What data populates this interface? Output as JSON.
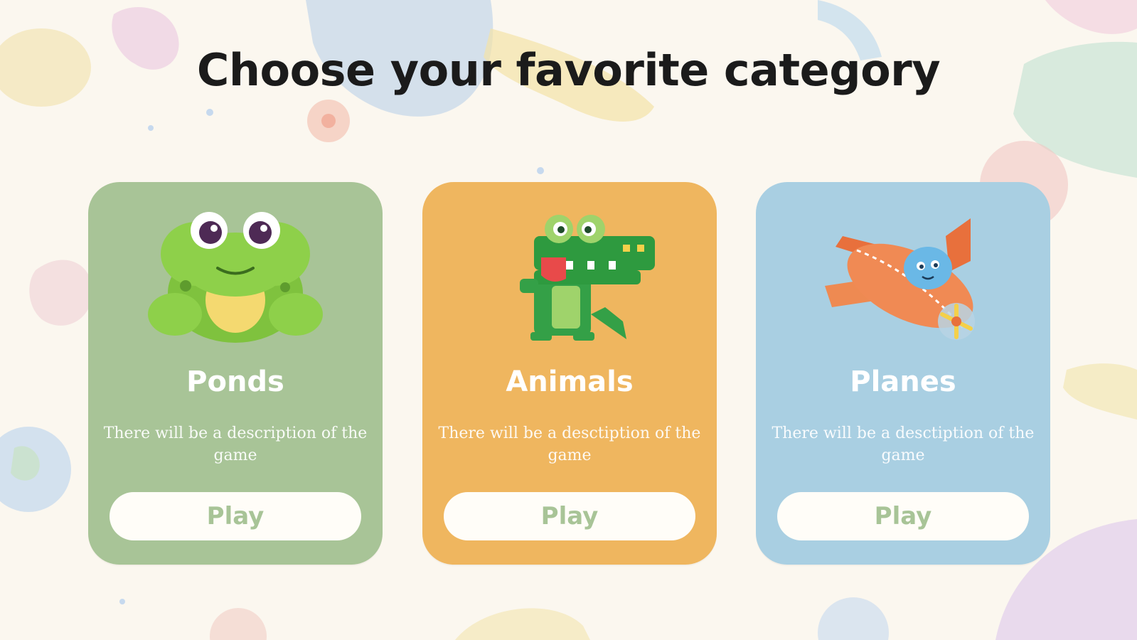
{
  "page": {
    "title": "Choose your favorite category"
  },
  "colors": {
    "background": "#fbf7ef",
    "card_green": "#a8c497",
    "card_orange": "#efb65f",
    "card_blue": "#a9cfe2",
    "button_bg": "#fffdf8",
    "button_text": "#a8c497"
  },
  "cards": [
    {
      "title": "Ponds",
      "description": "There will be a description of the game",
      "button_label": "Play",
      "icon": "frog-icon"
    },
    {
      "title": "Animals",
      "description": "There will be a desctiption of the game",
      "button_label": "Play",
      "icon": "crocodile-icon"
    },
    {
      "title": "Planes",
      "description": "There will be a desctiption of the game",
      "button_label": "Play",
      "icon": "airplane-icon"
    }
  ]
}
